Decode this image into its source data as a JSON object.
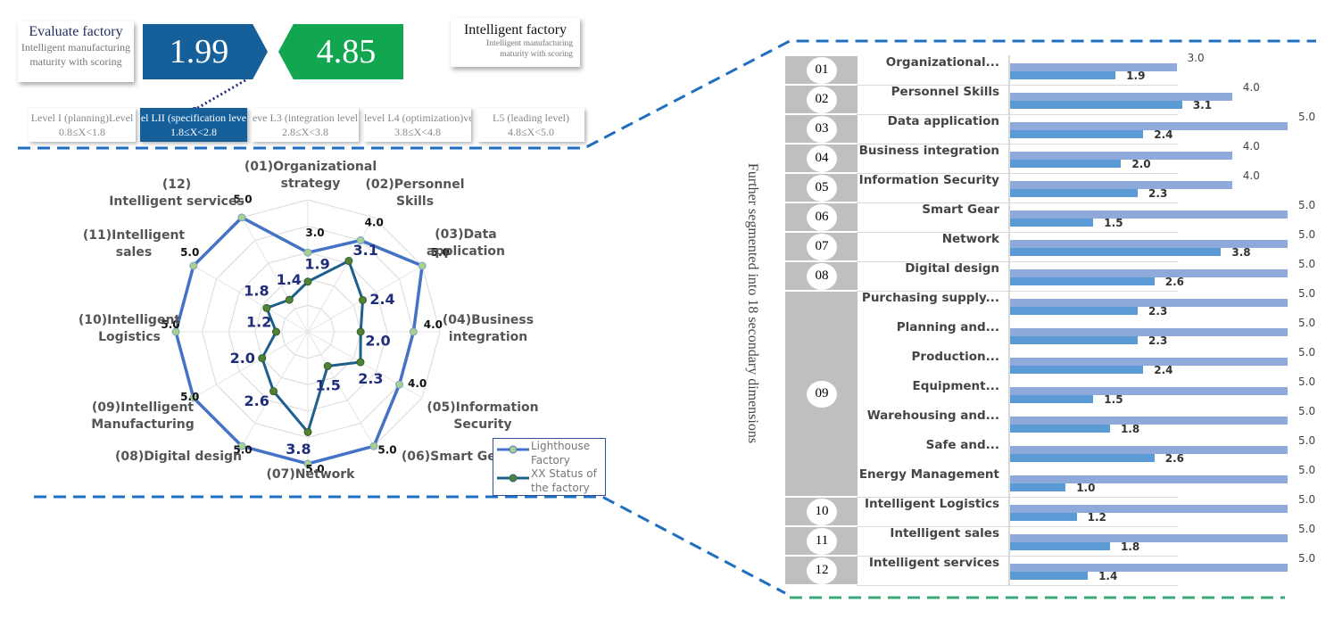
{
  "header": {
    "evaluate": {
      "title": "Evaluate factory",
      "subtitle_line1": "Intelligent manufacturing",
      "subtitle_line2": "maturity with scoring"
    },
    "evaluate_score": "1.99",
    "benchmark_score": "4.85",
    "intelligent": {
      "title": "Intelligent factory",
      "subtitle_line1": "Intelligent manufacturing",
      "subtitle_line2": "maturity with scoring"
    },
    "levels": [
      {
        "name": "Level I (planning)Level",
        "range": "0.8≤X<1.8",
        "active": false
      },
      {
        "name": "el  LII (specification leve",
        "range": "1.8≤X<2.8",
        "active": true
      },
      {
        "name": "eve L3 (integration level",
        "range": "2.8≤X<3.8",
        "active": false
      },
      {
        "name": "level L4 (optimization)vel",
        "range": "3.8≤X<4.8",
        "active": false
      },
      {
        "name": "L5 (leading level)",
        "range": "4.8≤X<5.0",
        "active": false
      }
    ],
    "colors": {
      "evaluate": "#155f9a",
      "benchmark": "#12a650"
    }
  },
  "side_caption": "Further segmented into 18 secondary dimensions",
  "chart_data": [
    {
      "type": "radar",
      "categories": [
        "(01)Organizational\nstrategy",
        "(02)Personnel\nSkills",
        "(03)Data\napplication",
        "(04)Business\nintegration",
        "(05)Information\nSecurity",
        "(06)Smart Gear",
        "(07)Network",
        "(08)Digital design",
        "(09)Intelligent\nManufacturing",
        "(10)Intelligent\nLogistics",
        "(11)Intelligent\nsales",
        "(12)\nIntelligent services"
      ],
      "range": [
        0,
        5
      ],
      "series": [
        {
          "name": "Lighthouse Factory",
          "color": "#4472c4",
          "values": [
            3.0,
            4.0,
            5.0,
            4.0,
            4.0,
            5.0,
            5.0,
            5.0,
            5.0,
            5.0,
            5.0,
            5.0
          ],
          "labels": [
            "3.0",
            "4.0",
            "5.0",
            "4.0",
            "4.0",
            "5.0",
            "5.0",
            "5.0",
            "5.0",
            "5.0",
            "5.0",
            "5.0"
          ]
        },
        {
          "name": "XX Status of the factory",
          "color": "#1f5f8b",
          "values": [
            1.9,
            3.1,
            2.4,
            2.0,
            2.3,
            1.5,
            3.8,
            2.6,
            2.0,
            1.2,
            1.8,
            1.4
          ],
          "labels": [
            "1.9",
            "3.1",
            "2.4",
            "2.0",
            "2.3",
            "1.5",
            "3.8",
            "2.6",
            "2.0",
            "1.2",
            "1.8",
            "1.4"
          ]
        }
      ],
      "legend": {
        "position": "bottom-right",
        "items": [
          "Lighthouse\nFactory",
          "XX Status of\nthe factory"
        ]
      },
      "grid": true
    },
    {
      "type": "bar",
      "orientation": "horizontal",
      "groups": [
        {
          "id": "01",
          "rows": [
            {
              "label": "Organizational...",
              "target": 3.0,
              "actual": 1.9
            }
          ]
        },
        {
          "id": "02",
          "rows": [
            {
              "label": "Personnel Skills",
              "target": 4.0,
              "actual": 3.1
            }
          ]
        },
        {
          "id": "03",
          "rows": [
            {
              "label": "Data application",
              "target": 5.0,
              "actual": 2.4
            }
          ]
        },
        {
          "id": "04",
          "rows": [
            {
              "label": "Business integration",
              "target": 4.0,
              "actual": 2.0
            }
          ]
        },
        {
          "id": "05",
          "rows": [
            {
              "label": "Information Security",
              "target": 4.0,
              "actual": 2.3
            }
          ]
        },
        {
          "id": "06",
          "rows": [
            {
              "label": "Smart Gear",
              "target": 5.0,
              "actual": 1.5
            }
          ]
        },
        {
          "id": "07",
          "rows": [
            {
              "label": "Network",
              "target": 5.0,
              "actual": 3.8
            }
          ]
        },
        {
          "id": "08",
          "rows": [
            {
              "label": "Digital design",
              "target": 5.0,
              "actual": 2.6
            }
          ]
        },
        {
          "id": "09",
          "rows": [
            {
              "label": "Purchasing supply...",
              "target": 5.0,
              "actual": 2.3
            },
            {
              "label": "Planning and...",
              "target": 5.0,
              "actual": 2.3
            },
            {
              "label": "Production...",
              "target": 5.0,
              "actual": 2.4
            },
            {
              "label": "Equipment...",
              "target": 5.0,
              "actual": 1.5
            },
            {
              "label": "Warehousing and...",
              "target": 5.0,
              "actual": 1.8
            },
            {
              "label": "Safe and...",
              "target": 5.0,
              "actual": 2.6
            },
            {
              "label": "Energy Management",
              "target": 5.0,
              "actual": 1.0
            }
          ]
        },
        {
          "id": "10",
          "rows": [
            {
              "label": "Intelligent Logistics",
              "target": 5.0,
              "actual": 1.2
            }
          ]
        },
        {
          "id": "11",
          "rows": [
            {
              "label": "Intelligent sales",
              "target": 5.0,
              "actual": 1.8
            }
          ]
        },
        {
          "id": "12",
          "rows": [
            {
              "label": "Intelligent services",
              "target": 5.0,
              "actual": 1.4
            }
          ]
        }
      ],
      "xlim": [
        0,
        5
      ],
      "colors": {
        "target": "#8eaadb",
        "actual": "#5b9bd5"
      }
    }
  ]
}
